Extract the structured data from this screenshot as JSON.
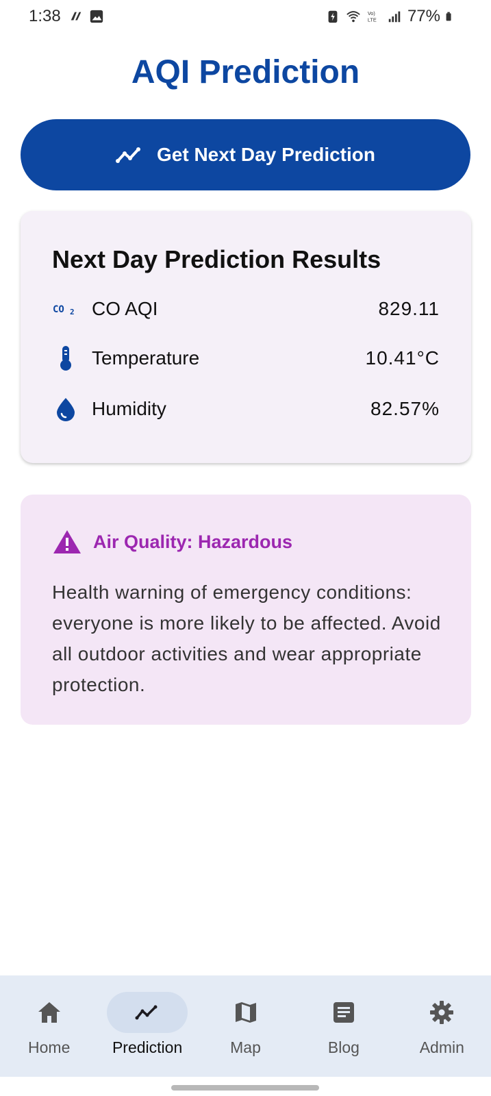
{
  "status_bar": {
    "time": "1:38",
    "battery": "77%"
  },
  "page": {
    "title": "AQI Prediction"
  },
  "predict_button": {
    "label": "Get Next Day Prediction",
    "icon": "trending-icon"
  },
  "results": {
    "title": "Next Day Prediction Results",
    "rows": [
      {
        "icon": "co2-icon",
        "label": "CO AQI",
        "value": "829.11"
      },
      {
        "icon": "thermometer-icon",
        "label": "Temperature",
        "value": "10.41°C"
      },
      {
        "icon": "water-drop-icon",
        "label": "Humidity",
        "value": "82.57%"
      }
    ]
  },
  "warning": {
    "icon": "warning-icon",
    "title": "Air Quality: Hazardous",
    "message": "Health warning of emergency conditions: everyone is more likely to be affected. Avoid all outdoor activities and wear appropriate protection."
  },
  "nav": {
    "items": [
      {
        "label": "Home",
        "icon": "home-icon",
        "active": false
      },
      {
        "label": "Prediction",
        "icon": "trending-icon",
        "active": true
      },
      {
        "label": "Map",
        "icon": "map-icon",
        "active": false
      },
      {
        "label": "Blog",
        "icon": "article-icon",
        "active": false
      },
      {
        "label": "Admin",
        "icon": "gear-icon",
        "active": false
      }
    ]
  },
  "colors": {
    "primary": "#0d47a1",
    "warning_accent": "#9c27b0",
    "card_bg": "#f5f0f8",
    "warning_bg": "#f4e6f6",
    "nav_bg": "#e4ebf5"
  }
}
